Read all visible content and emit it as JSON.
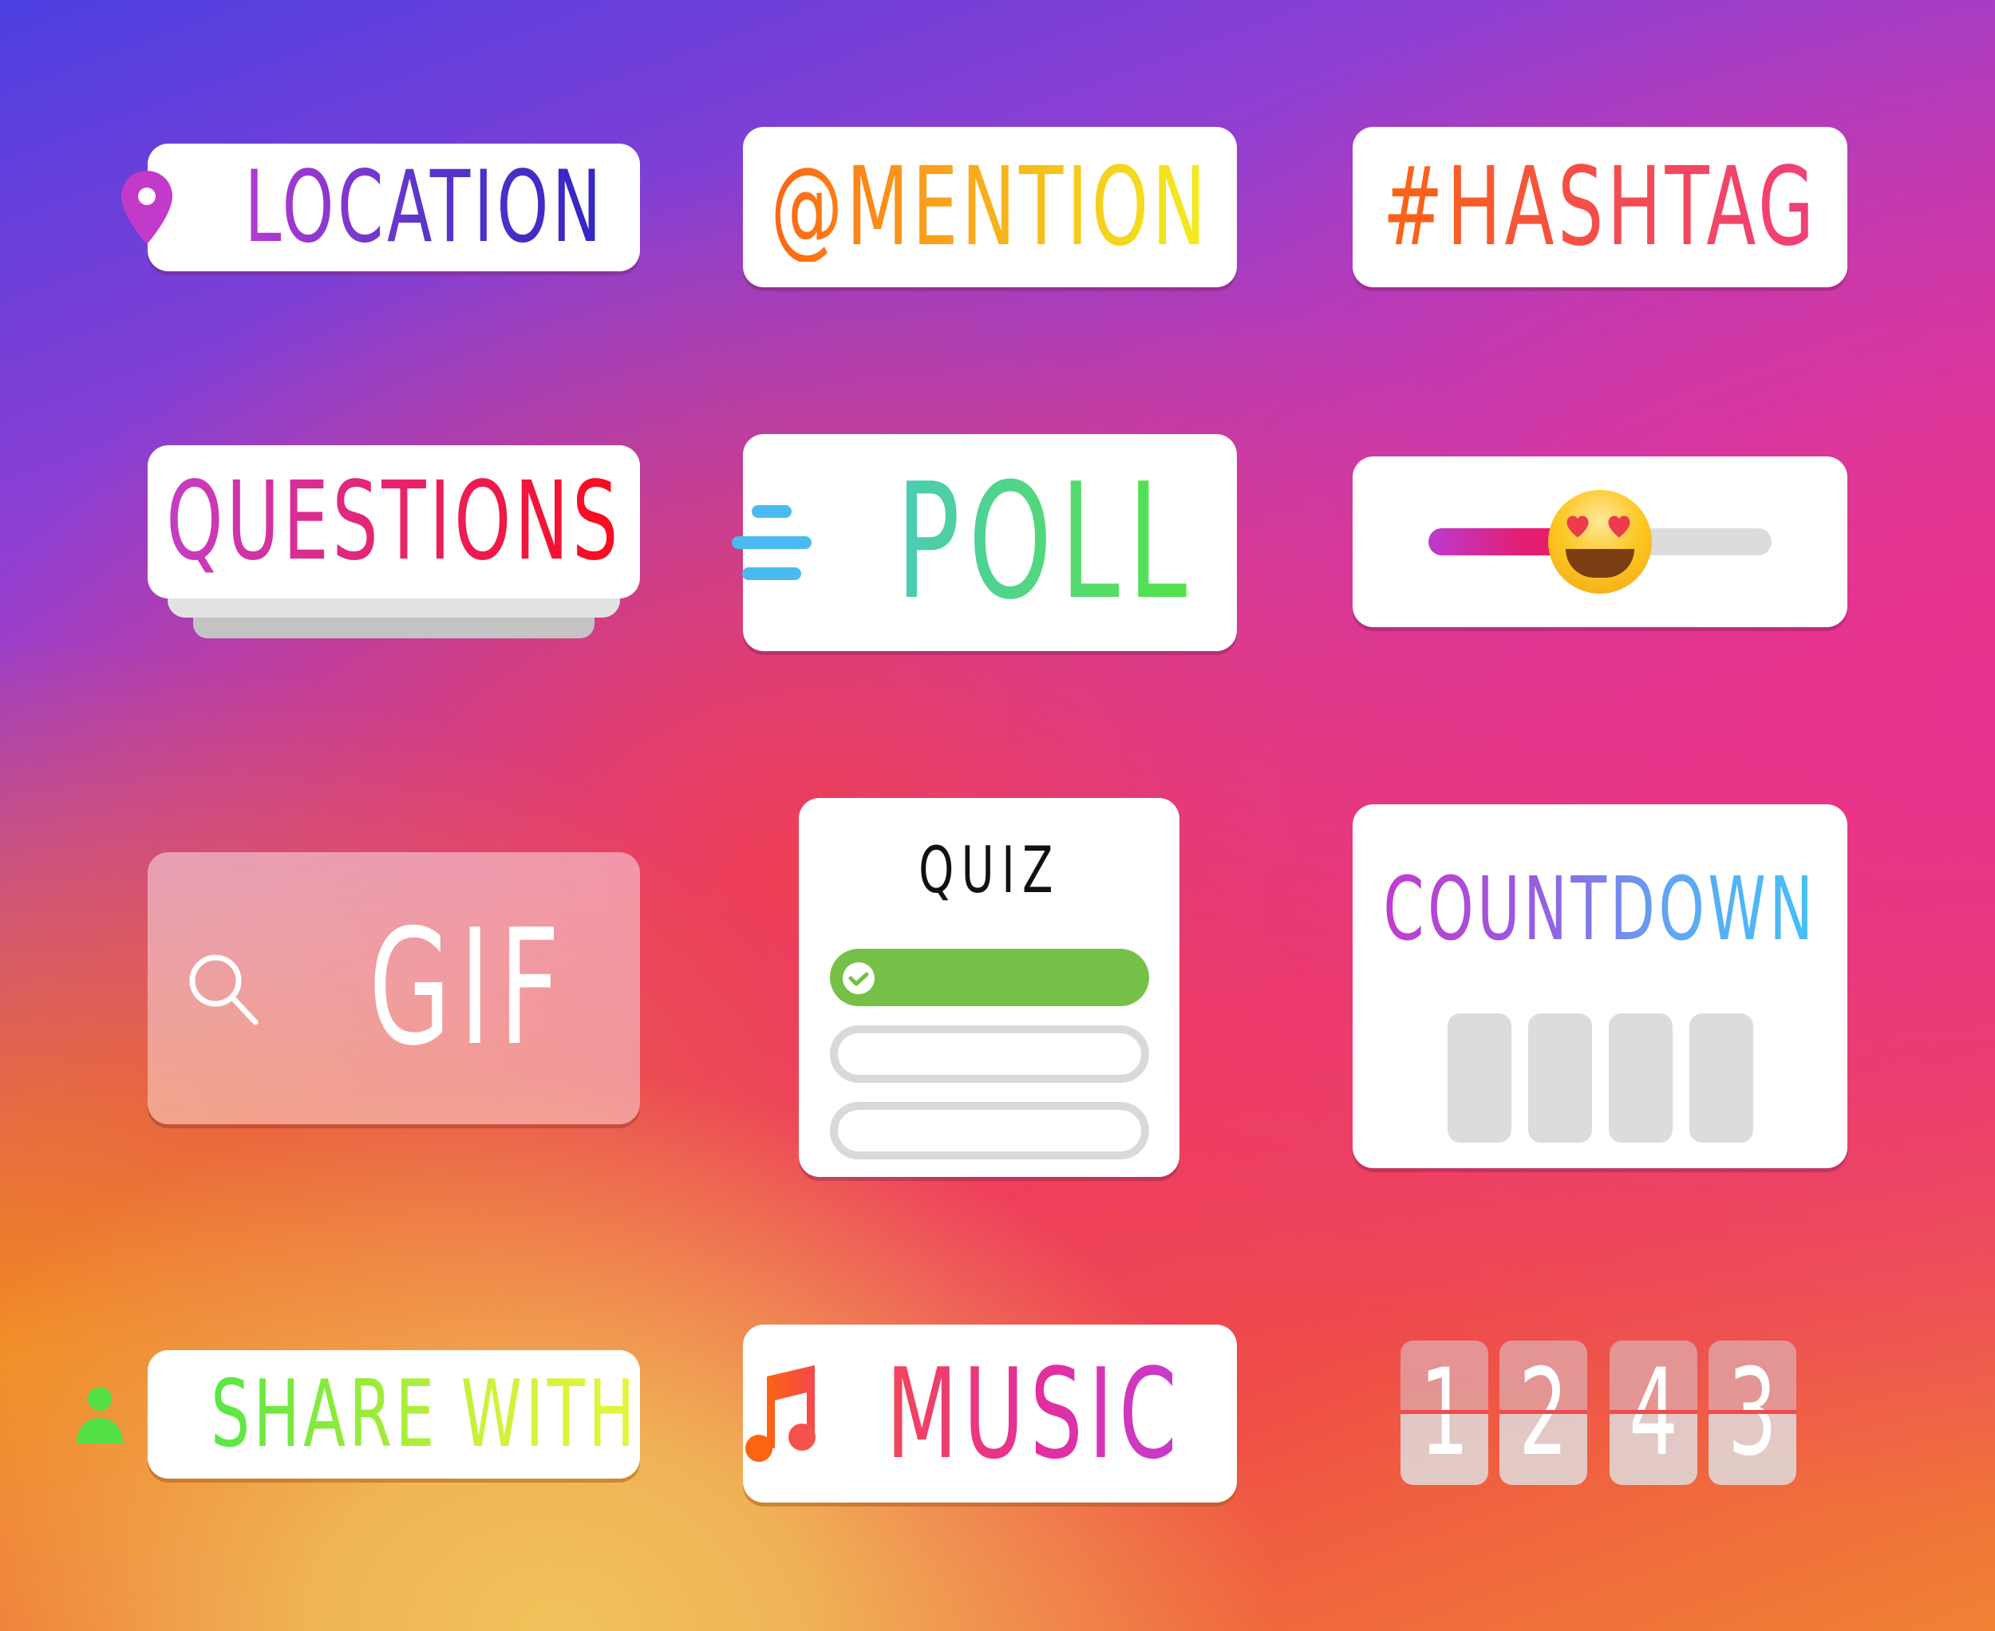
{
  "stickers": {
    "location": {
      "label": "LOCATION",
      "icon": "map-pin-icon"
    },
    "mention": {
      "label": "@MENTION"
    },
    "hashtag": {
      "label": "#HASHTAG"
    },
    "questions": {
      "label": "QUESTIONS"
    },
    "poll": {
      "label": "POLL",
      "icon": "poll-lines-icon"
    },
    "emoji_slider": {
      "emoji": "heart-eyes-emoji",
      "value_percent": 50
    },
    "gif": {
      "label": "GIF",
      "icon": "search-icon"
    },
    "quiz": {
      "title": "QUIZ",
      "options": [
        {
          "state": "correct"
        },
        {
          "state": "empty"
        },
        {
          "state": "empty"
        }
      ]
    },
    "countdown": {
      "label": "COUNTDOWN",
      "slots": 4
    },
    "share_with": {
      "label": "SHARE WITH",
      "icon": "person-icon"
    },
    "music": {
      "label": "MUSIC",
      "icon": "music-note-icon"
    },
    "flip_counter": {
      "digits": [
        "1",
        "2",
        "4",
        "3"
      ]
    }
  },
  "colors": {
    "background_top_left": "#4c3fe0",
    "background_mid": "#ec3a6a",
    "background_bottom": "#f0c25a",
    "quiz_correct": "#76c048",
    "poll_icon": "#4abbf0",
    "slot_gray": "#dcdcdc"
  }
}
